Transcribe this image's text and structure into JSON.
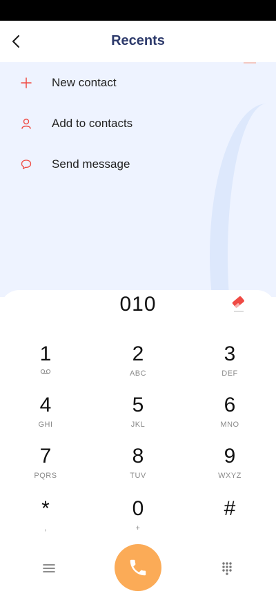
{
  "header": {
    "title": "Recents",
    "back_icon": "chevron-left-icon"
  },
  "actions": [
    {
      "label": "New contact",
      "icon": "plus-icon"
    },
    {
      "label": "Add to contacts",
      "icon": "person-icon"
    },
    {
      "label": "Send message",
      "icon": "chat-bubble-icon"
    }
  ],
  "dialer": {
    "number": "010",
    "erase_icon": "eraser-icon",
    "keys": [
      {
        "digit": "1",
        "letters": "",
        "sub_icon": "voicemail-icon"
      },
      {
        "digit": "2",
        "letters": "ABC"
      },
      {
        "digit": "3",
        "letters": "DEF"
      },
      {
        "digit": "4",
        "letters": "GHI"
      },
      {
        "digit": "5",
        "letters": "JKL"
      },
      {
        "digit": "6",
        "letters": "MNO"
      },
      {
        "digit": "7",
        "letters": "PQRS"
      },
      {
        "digit": "8",
        "letters": "TUV"
      },
      {
        "digit": "9",
        "letters": "WXYZ"
      },
      {
        "digit": "*",
        "letters": ","
      },
      {
        "digit": "0",
        "letters": "+"
      },
      {
        "digit": "#",
        "letters": ""
      }
    ]
  },
  "bottom_bar": {
    "menu_icon": "menu-icon",
    "call_icon": "phone-icon",
    "dialpad_icon": "dialpad-icon"
  },
  "colors": {
    "accent_red": "#ef4a44",
    "call_orange": "#fbab57",
    "title_navy": "#2d3a6b",
    "content_bg": "#eef3ff"
  }
}
